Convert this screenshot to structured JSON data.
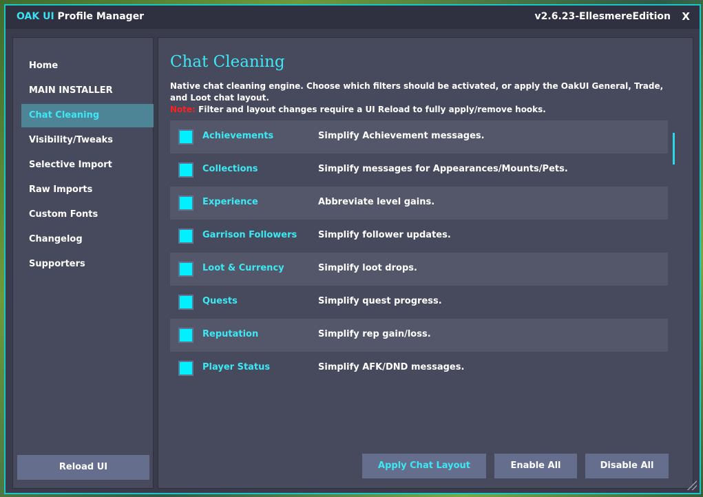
{
  "window": {
    "brand": "OAK UI",
    "title": " Profile Manager",
    "version": "v2.6.23-EllesmereEdition",
    "close": "X"
  },
  "sidebar": {
    "items": [
      {
        "label": "Home"
      },
      {
        "label": "MAIN INSTALLER"
      },
      {
        "label": "Chat Cleaning"
      },
      {
        "label": "Visibility/Tweaks"
      },
      {
        "label": "Selective Import"
      },
      {
        "label": "Raw Imports"
      },
      {
        "label": "Custom Fonts"
      },
      {
        "label": "Changelog"
      },
      {
        "label": "Supporters"
      }
    ],
    "active": "Chat Cleaning",
    "reload_label": "Reload UI"
  },
  "main": {
    "heading": "Chat Cleaning",
    "description": "Native chat cleaning engine. Choose which filters should be activated, or apply the OakUI General, Trade, and Loot chat layout.",
    "note_label": "Note:",
    "note_text": " Filter and layout changes require a UI Reload to fully apply/remove hooks.",
    "filters": [
      {
        "name": "Achievements",
        "desc": "Simplify Achievement messages.",
        "checked": true
      },
      {
        "name": "Collections",
        "desc": "Simplify messages for Appearances/Mounts/Pets.",
        "checked": true
      },
      {
        "name": "Experience",
        "desc": "Abbreviate level gains.",
        "checked": true
      },
      {
        "name": "Garrison Followers",
        "desc": "Simplify follower updates.",
        "checked": true
      },
      {
        "name": "Loot & Currency",
        "desc": "Simplify loot drops.",
        "checked": true
      },
      {
        "name": "Quests",
        "desc": "Simplify quest progress.",
        "checked": true
      },
      {
        "name": "Reputation",
        "desc": "Simplify rep gain/loss.",
        "checked": true
      },
      {
        "name": "Player Status",
        "desc": "Simplify AFK/DND messages.",
        "checked": true
      }
    ],
    "buttons": {
      "apply": "Apply Chat Layout",
      "enable": "Enable All",
      "disable": "Disable All"
    }
  },
  "colors": {
    "accent": "#3de8f5",
    "border": "#18c8c8",
    "note": "#ff2020",
    "checkbox": "#00f0ff"
  },
  "icons": {
    "resize": "resize-grip-icon"
  }
}
